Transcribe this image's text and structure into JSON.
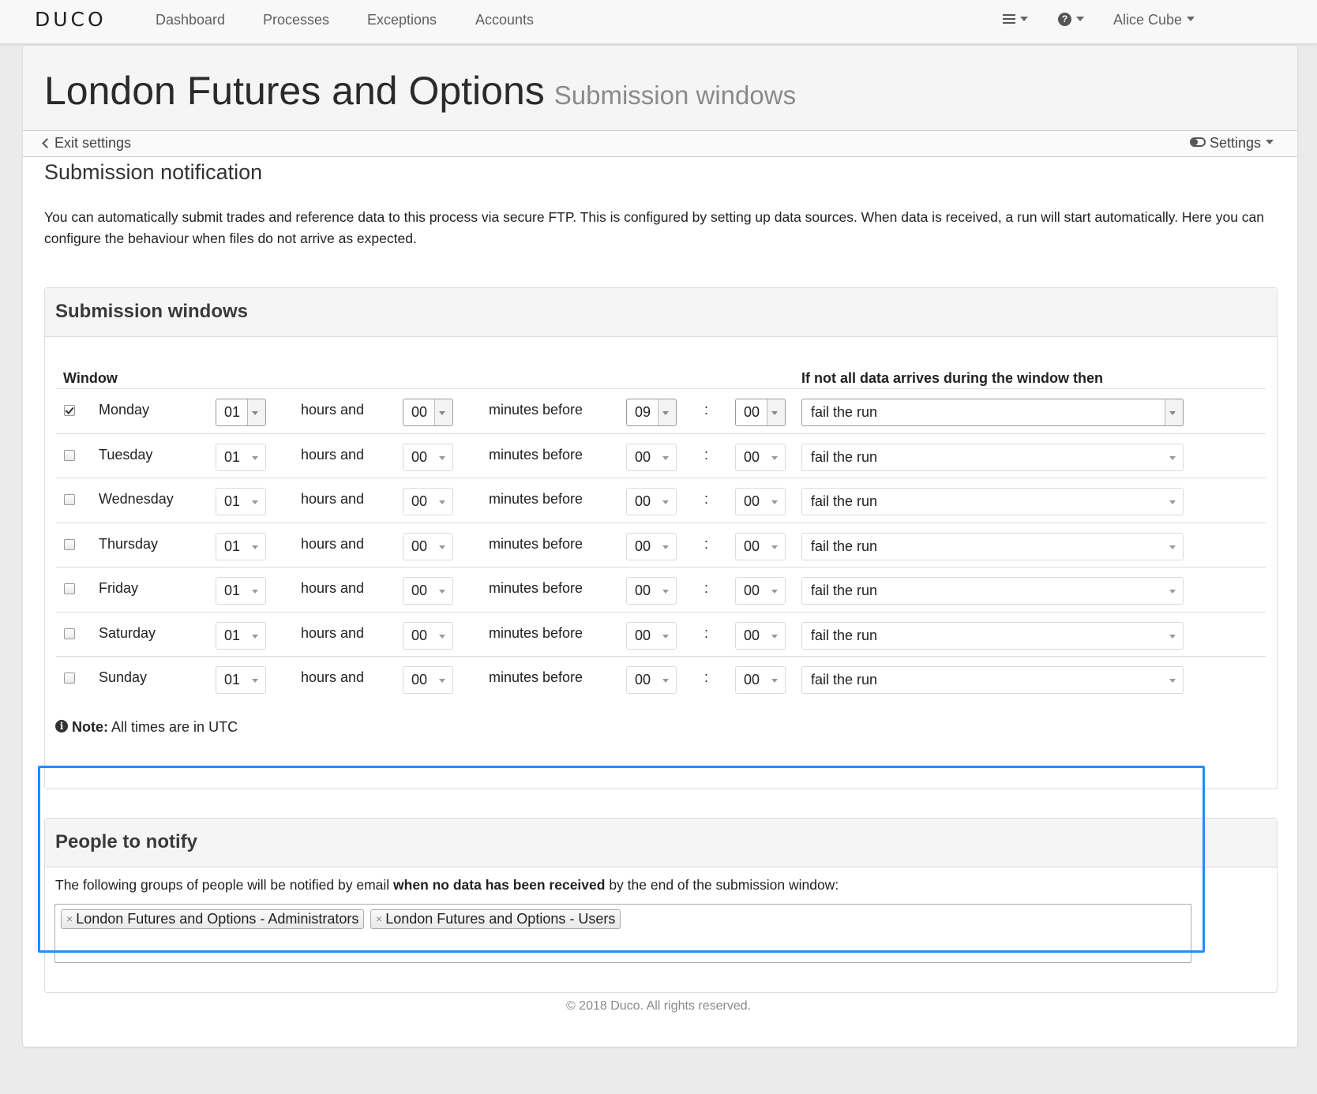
{
  "navbar": {
    "logo": "DUCO",
    "items": [
      "Dashboard",
      "Processes",
      "Exceptions",
      "Accounts"
    ],
    "user": "Alice Cube",
    "help_icon": "question-circle-icon",
    "menu_icon": "hamburger-icon"
  },
  "page": {
    "title": "London Futures and Options",
    "subtitle": "Submission windows",
    "exit_label": "Exit settings",
    "settings_label": "Settings",
    "section_title": "Submission notification",
    "intro": "You can automatically submit trades and reference data to this process via secure FTP. This is configured by setting up data sources. When data is received, a run will start automatically. Here you can configure the behaviour when files do not arrive as expected."
  },
  "windows": {
    "heading": "Submission windows",
    "col_window": "Window",
    "col_action": "If not all data arrives during the window then",
    "hours_label": "hours and",
    "minutes_label": "minutes before",
    "colon": ":",
    "rows": [
      {
        "day": "Monday",
        "checked": true,
        "hours": "01",
        "minutes": "00",
        "at_hour": "09",
        "at_min": "00",
        "action": "fail the run"
      },
      {
        "day": "Tuesday",
        "checked": false,
        "hours": "01",
        "minutes": "00",
        "at_hour": "00",
        "at_min": "00",
        "action": "fail the run"
      },
      {
        "day": "Wednesday",
        "checked": false,
        "hours": "01",
        "minutes": "00",
        "at_hour": "00",
        "at_min": "00",
        "action": "fail the run"
      },
      {
        "day": "Thursday",
        "checked": false,
        "hours": "01",
        "minutes": "00",
        "at_hour": "00",
        "at_min": "00",
        "action": "fail the run"
      },
      {
        "day": "Friday",
        "checked": false,
        "hours": "01",
        "minutes": "00",
        "at_hour": "00",
        "at_min": "00",
        "action": "fail the run"
      },
      {
        "day": "Saturday",
        "checked": false,
        "hours": "01",
        "minutes": "00",
        "at_hour": "00",
        "at_min": "00",
        "action": "fail the run"
      },
      {
        "day": "Sunday",
        "checked": false,
        "hours": "01",
        "minutes": "00",
        "at_hour": "00",
        "at_min": "00",
        "action": "fail the run"
      }
    ],
    "note_bold": "Note:",
    "note_text": "All times are in UTC"
  },
  "notify": {
    "heading": "People to notify",
    "text_pre": "The following groups of people will be notified by email ",
    "text_bold": "when no data has been received",
    "text_post": " by the end of the submission window:",
    "tags": [
      "London Futures and Options - Administrators",
      "London Futures and Options - Users"
    ],
    "highlight_color": "#1e90ff"
  },
  "footer": "© 2018 Duco. All rights reserved."
}
